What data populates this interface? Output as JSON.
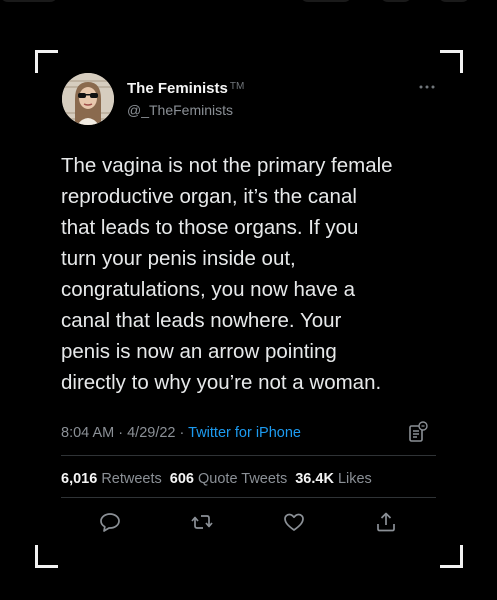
{
  "colors": {
    "background": "#000000",
    "text": "#e7e9ea",
    "secondary": "#8b9096",
    "link": "#1d9bf0",
    "divider": "#2f3336"
  },
  "author": {
    "display_name": "The Feminists",
    "tm": "TM",
    "handle": "@_TheFeminists"
  },
  "tweet": {
    "lines": [
      "The vagina is not the primary female",
      "reproductive organ, it’s the canal",
      "that leads to those organs. If you",
      "turn your penis inside out,",
      "congratulations, you now have a",
      "canal that leads nowhere. Your",
      "penis is now an arrow pointing",
      "directly to why you’re not a woman."
    ]
  },
  "meta": {
    "time": "8:04 AM",
    "sep": "·",
    "date": "4/29/22",
    "source": "Twitter for iPhone"
  },
  "stats": {
    "retweets_count": "6,016",
    "retweets_label": "Retweets",
    "quotes_count": "606",
    "quotes_label": "Quote Tweets",
    "likes_count": "36.4K",
    "likes_label": "Likes"
  },
  "icons": {
    "more": "more-icon",
    "analytics": "analytics-icon",
    "reply": "reply-icon",
    "retweet": "retweet-icon",
    "like": "like-icon",
    "share": "share-icon"
  }
}
